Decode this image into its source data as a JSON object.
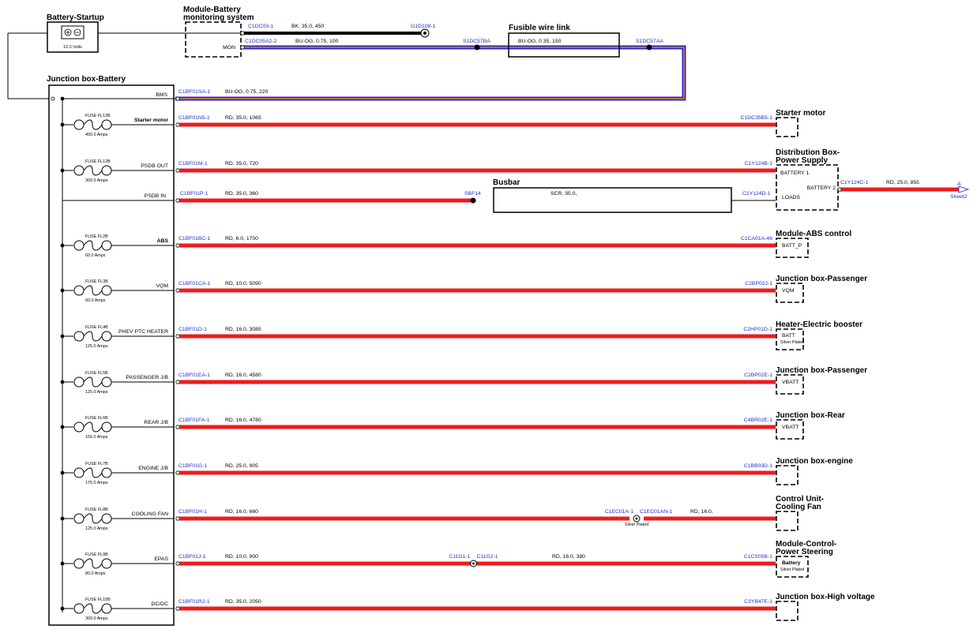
{
  "battery": {
    "title": "Battery-Startup",
    "voltage": "12.0 Volts"
  },
  "bms_module": {
    "title1": "Module-Battery",
    "title2": "monitoring system",
    "pin": "MON"
  },
  "fusible_link": {
    "title": "Fusible wire link",
    "spec": "BU-OG, 0.35, 150"
  },
  "top_wires": {
    "bk_conn": "C1DC03-1",
    "bk_spec": "BK, 35.0, 450",
    "ground_conn": "G1D108-1",
    "mon_conn": "C1DC05A2-2",
    "mon_spec": "BU-OG, 0.75, 100",
    "splice1": "S1DC57BA",
    "splice2": "S1DC57AA"
  },
  "junction_box": {
    "title": "Junction box-Battery"
  },
  "bms_wire": {
    "pin": "BMS",
    "conn": "C1BF01SA-1",
    "spec": "BU-OG, 0.75, 220"
  },
  "busbar": {
    "title": "Busbar",
    "spec": "SCR, 35.0,",
    "splice": "SBF14"
  },
  "psdb_in": {
    "pin": "PSDB IN",
    "conn": "C1BF01P-1",
    "spec": "RD, 35.0, 360",
    "dest_conn": "C1Y124D-1"
  },
  "distribution": {
    "title1": "Distribution Box-",
    "title2": "Power Supply",
    "pin1": "BATTERY 1",
    "pin2": "BATTERY 2",
    "pin3": "LOADS",
    "out_conn": "C1Y124C-1",
    "out_spec": "RD, 25.0, 855",
    "sheet_label": "A",
    "sheet_ref": "Sheet2"
  },
  "circuits": [
    {
      "fuse": "FUSE FL13B",
      "amps": "400.0 Amps",
      "pin": "Starter motor",
      "conn": "C1BF01N5-1",
      "spec": "RD, 35.0, 1065",
      "dest_conn": "C1DC35B5-1",
      "dest_title": "Starter motor",
      "dest_title2": "",
      "box_pin": "",
      "box_sub": ""
    },
    {
      "fuse": "FUSE FL12B",
      "amps": "300.0 Amps",
      "pin": "PSDB OUT",
      "conn": "C1BF01M-1",
      "spec": "RD, 35.0, 720",
      "dest_conn": "C1Y124B-1",
      "dest_title": "",
      "dest_title2": "",
      "box_pin": "",
      "box_sub": ""
    },
    {
      "fuse": "FUSE FL2B",
      "amps": "60.0 Amps",
      "pin": "ABS",
      "conn": "C1BF01BC-1",
      "spec": "RD, 6.0, 1700",
      "dest_conn": "C1CA01A-46",
      "dest_title": "Module-ABS control",
      "dest_title2": "",
      "box_pin": "BATT_P",
      "box_sub": ""
    },
    {
      "fuse": "FUSE FL3B",
      "amps": "60.0 Amps",
      "pin": "VQM",
      "conn": "C1BF01CA-1",
      "spec": "RD, 10.0, 5090",
      "dest_conn": "C2BP02J-1",
      "dest_title": "Junction box-Passenger",
      "dest_title2": "",
      "box_pin": "VQM",
      "box_sub": ""
    },
    {
      "fuse": "FUSE FL4B",
      "amps": "125.0 Amps",
      "pin": "PHEV PTC HEATER",
      "conn": "C1BF01D-1",
      "spec": "RD, 16.0, 3085",
      "dest_conn": "C2HP01D-1",
      "dest_title": "Heater-Electric booster",
      "dest_title2": "",
      "box_pin": "BATT",
      "box_sub": "Silver Plated"
    },
    {
      "fuse": "FUSE FL5B",
      "amps": "125.0 Amps",
      "pin": "PASSENGER J/B",
      "conn": "C1BF01EA-1",
      "spec": "RD, 16.0, 4580",
      "dest_conn": "C2BP02E-1",
      "dest_title": "Junction box-Passenger",
      "dest_title2": "",
      "box_pin": "VBATT",
      "box_sub": ""
    },
    {
      "fuse": "FUSE FL6B",
      "amps": "150.0 Amps",
      "pin": "REAR J/B",
      "conn": "C1BF01FA-1",
      "spec": "RD, 16.0, 4780",
      "dest_conn": "C4BR02E-1",
      "dest_title": "Junction box-Rear",
      "dest_title2": "",
      "box_pin": "VBATT",
      "box_sub": ""
    },
    {
      "fuse": "FUSE FL7B",
      "amps": "175.0 Amps",
      "pin": "ENGINE J/B",
      "conn": "C1BF01G-1",
      "spec": "RD, 25.0, 905",
      "dest_conn": "C1BB03D-1",
      "dest_title": "Junction box-engine",
      "dest_title2": "",
      "box_pin": "",
      "box_sub": ""
    },
    {
      "fuse": "FUSE FL8B",
      "amps": "125.0 Amps",
      "pin": "COOLING FAN",
      "conn": "C1BF01H-1",
      "spec": "RD, 16.0, 660",
      "dest_conn": "",
      "dest_title": "Control Unit-",
      "dest_title2": "Cooling Fan",
      "box_pin": "",
      "box_sub": "",
      "inline": {
        "conn_a": "C1EC01A-1",
        "conn_b": "C1EC01AN-1",
        "note": "Silver Plated",
        "spec2": "RD, 16.0,"
      }
    },
    {
      "fuse": "FUSE FL9B",
      "amps": "80.0 Amps",
      "pin": "EPAS",
      "conn": "C1BF01J-1",
      "spec": "RD, 10.0, 900",
      "dest_conn": "C1CS05B-1",
      "dest_title": "Module-Control-",
      "dest_title2": "Power Steering",
      "box_pin": "Battery",
      "box_sub": "Silver Plated",
      "inline": {
        "conn_a": "C11G1-1",
        "conn_b": "C11G2-1",
        "note": "",
        "spec2": "RD, 16.0, 380"
      }
    },
    {
      "fuse": "FUSE FL15B",
      "amps": "300.0 Amps",
      "pin": "DC/DC",
      "conn": "C1BF01R2-1",
      "spec": "RD, 35.0, 2050",
      "dest_conn": "C3YB47E-1",
      "dest_title": "Junction box-High voltage",
      "dest_title2": "",
      "box_pin": "",
      "box_sub": ""
    }
  ],
  "colors": {
    "wire_red": "#ee1c1c",
    "wire_blue": "#2424c8",
    "wire_orange": "#e8812a",
    "conn_blue": "#1f2fc8"
  }
}
